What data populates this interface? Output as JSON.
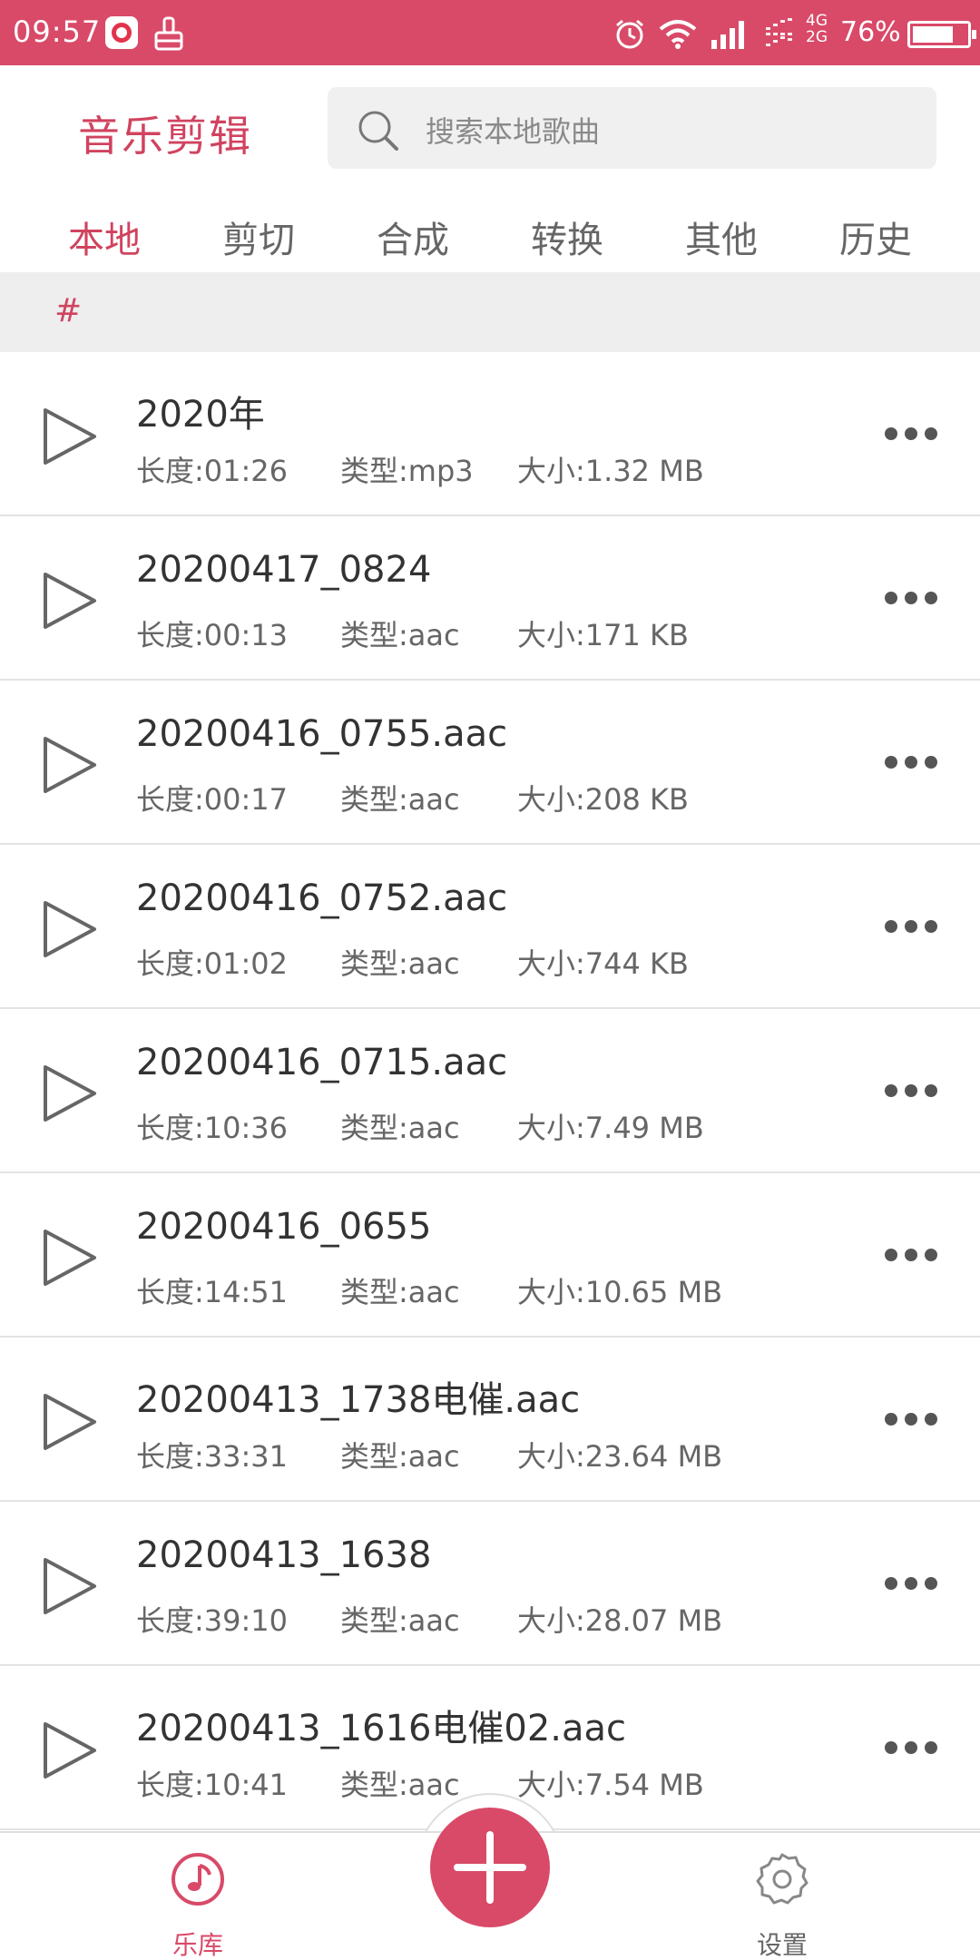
{
  "status_bar": {
    "time": "09:57",
    "network_top": "4G",
    "network_bottom": "2G",
    "battery": "76%",
    "battery_level": 0.76,
    "icons": [
      "netease-music-icon",
      "broom-icon",
      "alarm-icon",
      "wifi-icon",
      "signal-icon",
      "signal-icon-2",
      "battery-icon"
    ]
  },
  "header": {
    "title": "音乐剪辑",
    "search_placeholder": "搜索本地歌曲"
  },
  "tabs": [
    {
      "label": "本地",
      "active": true
    },
    {
      "label": "剪切",
      "active": false
    },
    {
      "label": "合成",
      "active": false
    },
    {
      "label": "转换",
      "active": false
    },
    {
      "label": "其他",
      "active": false
    },
    {
      "label": "历史",
      "active": false
    }
  ],
  "section": {
    "label": "#"
  },
  "songs": [
    {
      "title": "2020年",
      "length": "长度:01:26",
      "type": "类型:mp3",
      "size": "大小:1.32 MB"
    },
    {
      "title": "20200417_0824",
      "length": "长度:00:13",
      "type": "类型:aac",
      "size": "大小:171 KB"
    },
    {
      "title": "20200416_0755.aac",
      "length": "长度:00:17",
      "type": "类型:aac",
      "size": "大小:208 KB"
    },
    {
      "title": "20200416_0752.aac",
      "length": "长度:01:02",
      "type": "类型:aac",
      "size": "大小:744 KB"
    },
    {
      "title": "20200416_0715.aac",
      "length": "长度:10:36",
      "type": "类型:aac",
      "size": "大小:7.49 MB"
    },
    {
      "title": "20200416_0655",
      "length": "长度:14:51",
      "type": "类型:aac",
      "size": "大小:10.65 MB"
    },
    {
      "title": "20200413_1738电催.aac",
      "length": "长度:33:31",
      "type": "类型:aac",
      "size": "大小:23.64 MB"
    },
    {
      "title": "20200413_1638",
      "length": "长度:39:10",
      "type": "类型:aac",
      "size": "大小:28.07 MB"
    },
    {
      "title": "20200413_1616电催02.aac",
      "length": "长度:10:41",
      "type": "类型:aac",
      "size": "大小:7.54 MB"
    }
  ],
  "bottom_nav": {
    "library_label": "乐库",
    "settings_label": "设置",
    "add_icon": "plus-icon"
  },
  "colors": {
    "accent": "#d94a68",
    "title": "#d0435f",
    "inactive": "#666666"
  }
}
